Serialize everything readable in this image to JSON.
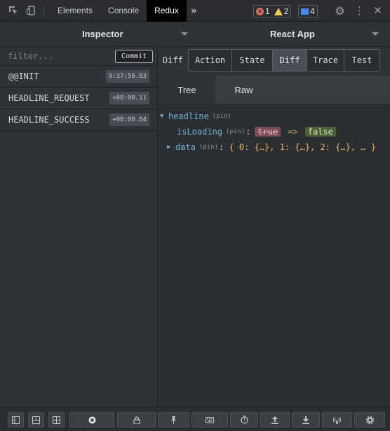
{
  "devtools": {
    "tabs": [
      "Elements",
      "Console",
      "Redux"
    ],
    "active_tab": "Redux",
    "more_glyph": "»",
    "errors": "1",
    "warnings": "2",
    "messages": "4"
  },
  "header": {
    "left_title": "Inspector",
    "right_title": "React App"
  },
  "actions_panel": {
    "filter_placeholder": "filter...",
    "commit_label": "Commit",
    "items": [
      {
        "name": "@@INIT",
        "time": "9:37:56.83"
      },
      {
        "name": "HEADLINE_REQUEST",
        "time": "+00:00.11"
      },
      {
        "name": "HEADLINE_SUCCESS",
        "time": "+00:00.84"
      }
    ]
  },
  "monitor": {
    "label": "Diff",
    "tabs": [
      "Action",
      "State",
      "Diff",
      "Trace",
      "Test"
    ],
    "active_tab": "Diff",
    "subtabs": [
      "Tree",
      "Raw"
    ],
    "active_subtab": "Tree"
  },
  "diff_tree": {
    "root_key": "headline",
    "pin": "(pin)",
    "loading_key": "isLoading",
    "old_value": "true",
    "arrow": "=>",
    "new_value": "false",
    "data_key": "data",
    "data_preview": "{ 0: {…}, 1: {…}, 2: {…}, … }"
  }
}
